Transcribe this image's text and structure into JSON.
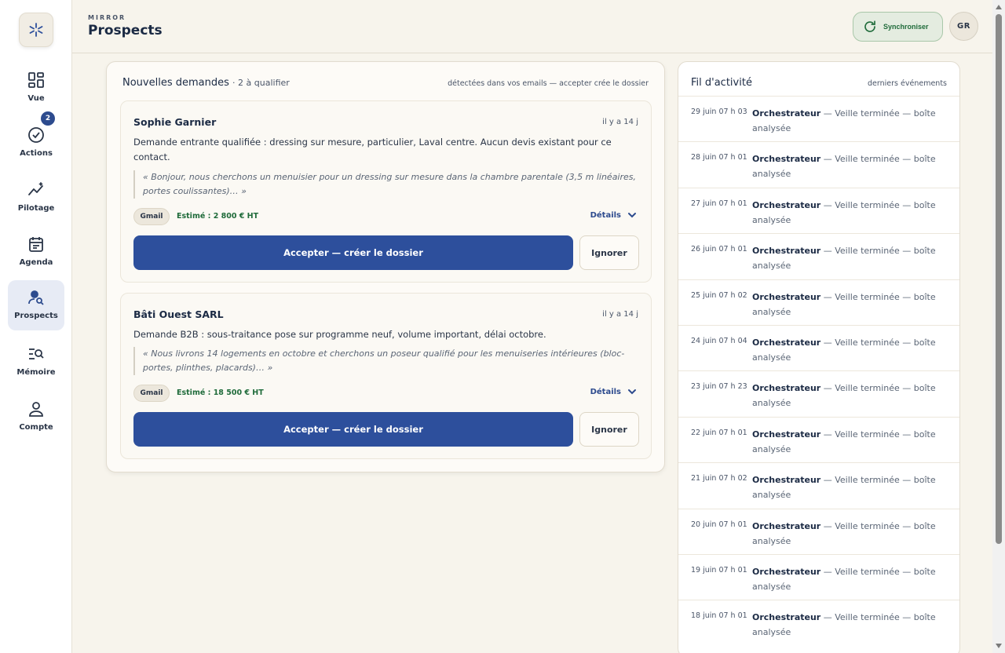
{
  "app": {
    "brand": "MIRROR",
    "page_title": "Prospects"
  },
  "sidebar": {
    "items": [
      {
        "label": "Vue",
        "icon": "dashboard-icon"
      },
      {
        "label": "Actions",
        "icon": "check-circle-icon",
        "badge": "2"
      },
      {
        "label": "Pilotage",
        "icon": "trend-sparkle-icon"
      },
      {
        "label": "Agenda",
        "icon": "calendar-icon"
      },
      {
        "label": "Prospects",
        "icon": "user-search-icon",
        "active": true
      },
      {
        "label": "Mémoire",
        "icon": "list-search-icon"
      },
      {
        "label": "Compte",
        "icon": "user-icon"
      }
    ]
  },
  "header": {
    "sync_label": "Synchroniser",
    "avatar_initials": "GR"
  },
  "requests": {
    "title": "Nouvelles demandes",
    "count": "· 2 à qualifier",
    "hint": "détectées dans vos emails — accepter crée le dossier",
    "cards": [
      {
        "name": "Sophie Garnier",
        "time": "il y a 14 j",
        "description": "Demande entrante qualifiée : dressing sur mesure, particulier, Laval centre. Aucun devis existant pour ce contact.",
        "quote": "« Bonjour, nous cherchons un menuisier pour un dressing sur mesure dans la chambre parentale (3,5 m linéaires, portes coulissantes)… »",
        "source": "Gmail",
        "estimate": "Estimé : 2 800 € HT",
        "details": "Détails",
        "accept": "Accepter — créer le dossier",
        "ignore": "Ignorer"
      },
      {
        "name": "Bâti Ouest SARL",
        "time": "il y a 14 j",
        "description": "Demande B2B : sous-traitance pose sur programme neuf, volume important, délai octobre.",
        "quote": "« Nous livrons 14 logements en octobre et cherchons un poseur qualifié pour les menuiseries intérieures (bloc-portes, plinthes, placards)… »",
        "source": "Gmail",
        "estimate": "Estimé : 18 500 € HT",
        "details": "Détails",
        "accept": "Accepter — créer le dossier",
        "ignore": "Ignorer"
      }
    ]
  },
  "activity": {
    "title": "Fil d'activité",
    "hint": "derniers événements",
    "items": [
      {
        "time": "29 juin 07 h 03",
        "actor": "Orchestrateur",
        "text": " — Veille terminée — boîte analysée"
      },
      {
        "time": "28 juin 07 h 01",
        "actor": "Orchestrateur",
        "text": " — Veille terminée — boîte analysée"
      },
      {
        "time": "27 juin 07 h 01",
        "actor": "Orchestrateur",
        "text": " — Veille terminée — boîte analysée"
      },
      {
        "time": "26 juin 07 h 01",
        "actor": "Orchestrateur",
        "text": " — Veille terminée — boîte analysée"
      },
      {
        "time": "25 juin 07 h 02",
        "actor": "Orchestrateur",
        "text": " — Veille terminée — boîte analysée"
      },
      {
        "time": "24 juin 07 h 04",
        "actor": "Orchestrateur",
        "text": " — Veille terminée — boîte analysée"
      },
      {
        "time": "23 juin 07 h 23",
        "actor": "Orchestrateur",
        "text": " — Veille terminée — boîte analysée"
      },
      {
        "time": "22 juin 07 h 01",
        "actor": "Orchestrateur",
        "text": " — Veille terminée — boîte analysée"
      },
      {
        "time": "21 juin 07 h 02",
        "actor": "Orchestrateur",
        "text": " — Veille terminée — boîte analysée"
      },
      {
        "time": "20 juin 07 h 01",
        "actor": "Orchestrateur",
        "text": " — Veille terminée — boîte analysée"
      },
      {
        "time": "19 juin 07 h 01",
        "actor": "Orchestrateur",
        "text": " — Veille terminée — boîte analysée"
      },
      {
        "time": "18 juin 07 h 01",
        "actor": "Orchestrateur",
        "text": " — Veille terminée — boîte analysée"
      }
    ]
  },
  "colors": {
    "primary": "#2d4f9c",
    "success": "#1f6b3a",
    "background": "#f7f4ec"
  }
}
